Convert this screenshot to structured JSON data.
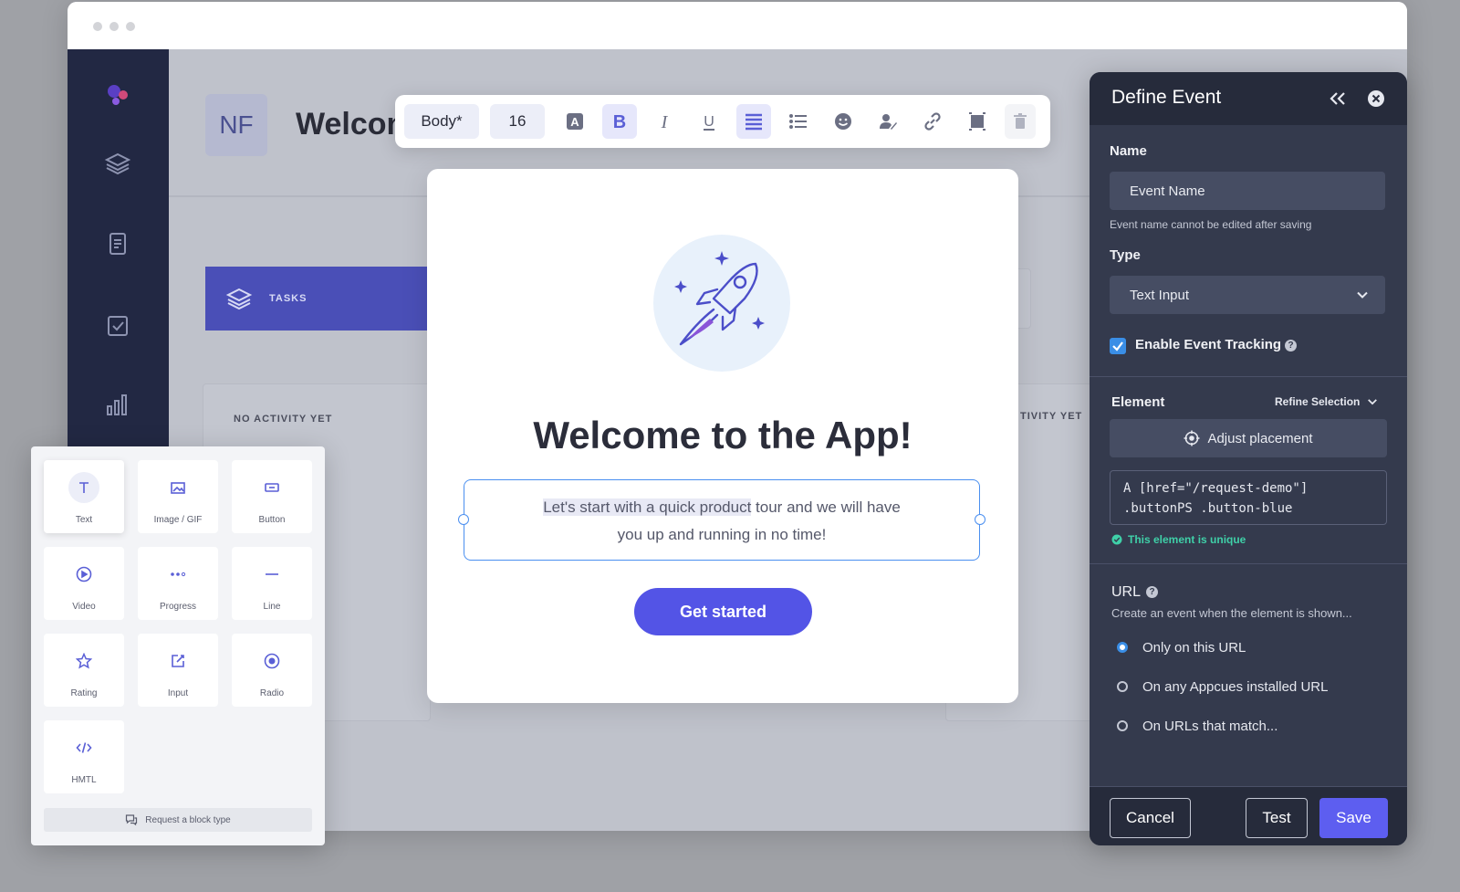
{
  "background_app": {
    "avatar_initials": "NF",
    "title": "Welcom",
    "tasks_label": "TASKS",
    "no_activity_label": "NO ACTIVITY YET",
    "activity_partial_label": "TIVITY YET"
  },
  "toolbar": {
    "style_select": "Body*",
    "size_select": "16",
    "buttons": [
      "text-color",
      "bold",
      "italic",
      "underline",
      "align",
      "list",
      "emoji",
      "personalize",
      "link",
      "image",
      "delete"
    ],
    "active_buttons": [
      "bold",
      "align"
    ]
  },
  "modal": {
    "title": "Welcome to the App!",
    "body_highlight": "Let's start with a quick product",
    "body_rest": " tour and we will have",
    "body_line2": "you up and running in no time!",
    "cta": "Get started"
  },
  "palette": {
    "blocks": [
      {
        "label": "Text",
        "icon": "text-icon"
      },
      {
        "label": "Image / GIF",
        "icon": "image-icon"
      },
      {
        "label": "Button",
        "icon": "button-icon"
      },
      {
        "label": "Video",
        "icon": "play-icon"
      },
      {
        "label": "Progress",
        "icon": "dots-icon"
      },
      {
        "label": "Line",
        "icon": "line-icon"
      },
      {
        "label": "Rating",
        "icon": "star-icon"
      },
      {
        "label": "Input",
        "icon": "edit-icon"
      },
      {
        "label": "Radio",
        "icon": "radio-icon"
      },
      {
        "label": "HMTL",
        "icon": "code-icon"
      }
    ],
    "request_label": "Request a block type"
  },
  "panel": {
    "title": "Define Event",
    "name_label": "Name",
    "name_value": "Event Name",
    "name_hint": "Event name cannot be edited after saving",
    "type_label": "Type",
    "type_value": "Text Input",
    "tracking_label": "Enable Event Tracking",
    "tracking_checked": true,
    "element_label": "Element",
    "refine_label": "Refine Selection",
    "adjust_label": "Adjust placement",
    "selector_line1": "A [href=\"/request-demo\"]",
    "selector_line2": ".buttonPS .button-blue",
    "unique_label": "This element is unique",
    "url_label": "URL",
    "url_hint": "Create an event when the element is shown...",
    "url_options": [
      "Only on this URL",
      "On any Appcues installed URL",
      "On URLs that match..."
    ],
    "url_selected": "Only on this URL",
    "cancel": "Cancel",
    "test": "Test",
    "save": "Save"
  },
  "colors": {
    "accent": "#5354e6",
    "nav": "#222843",
    "panel": "#343a4d",
    "success": "#3fd0a8",
    "selection": "#4a8ff0"
  }
}
